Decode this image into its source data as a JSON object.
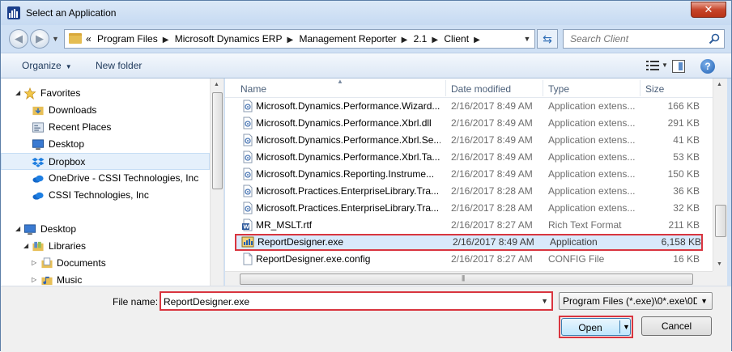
{
  "window": {
    "title": "Select an Application",
    "close_glyph": "✕"
  },
  "address": {
    "prefix": "«",
    "crumbs": [
      "Program Files",
      "Microsoft Dynamics ERP",
      "Management Reporter",
      "2.1",
      "Client"
    ],
    "search_placeholder": "Search Client"
  },
  "toolbar": {
    "organize": "Organize",
    "new_folder": "New folder",
    "help": "?"
  },
  "nav": {
    "items": [
      {
        "label": "Favorites",
        "icon": "star-icon",
        "level": 0,
        "expanded": true
      },
      {
        "label": "Downloads",
        "icon": "downloads-folder-icon",
        "level": 1
      },
      {
        "label": "Recent Places",
        "icon": "recent-places-icon",
        "level": 1
      },
      {
        "label": "Desktop",
        "icon": "desktop-icon",
        "level": 1
      },
      {
        "label": "Dropbox",
        "icon": "dropbox-icon",
        "level": 1,
        "selected": true
      },
      {
        "label": "OneDrive - CSSI Technologies, Inc",
        "icon": "onedrive-icon",
        "level": 1
      },
      {
        "label": "CSSI Technologies, Inc",
        "icon": "onedrive-icon",
        "level": 1
      },
      {
        "label": "Desktop",
        "icon": "desktop-icon",
        "level": 0,
        "expanded": true
      },
      {
        "label": "Libraries",
        "icon": "libraries-icon",
        "level": 1,
        "expanded": true
      },
      {
        "label": "Documents",
        "icon": "documents-icon",
        "level": 2
      },
      {
        "label": "Music",
        "icon": "music-icon",
        "level": 2
      }
    ]
  },
  "files": {
    "columns": {
      "name": "Name",
      "date": "Date modified",
      "type": "Type",
      "size": "Size"
    },
    "rows": [
      {
        "name": "Microsoft.Dynamics.Performance.Wizard...",
        "date": "2/16/2017 8:49 AM",
        "type": "Application extens...",
        "size": "166 KB",
        "icon": "dll-icon"
      },
      {
        "name": "Microsoft.Dynamics.Performance.Xbrl.dll",
        "date": "2/16/2017 8:49 AM",
        "type": "Application extens...",
        "size": "291 KB",
        "icon": "dll-icon"
      },
      {
        "name": "Microsoft.Dynamics.Performance.Xbrl.Se...",
        "date": "2/16/2017 8:49 AM",
        "type": "Application extens...",
        "size": "41 KB",
        "icon": "dll-icon"
      },
      {
        "name": "Microsoft.Dynamics.Performance.Xbrl.Ta...",
        "date": "2/16/2017 8:49 AM",
        "type": "Application extens...",
        "size": "53 KB",
        "icon": "dll-icon"
      },
      {
        "name": "Microsoft.Dynamics.Reporting.Instrume...",
        "date": "2/16/2017 8:49 AM",
        "type": "Application extens...",
        "size": "150 KB",
        "icon": "dll-icon"
      },
      {
        "name": "Microsoft.Practices.EnterpriseLibrary.Tra...",
        "date": "2/16/2017 8:28 AM",
        "type": "Application extens...",
        "size": "36 KB",
        "icon": "dll-icon"
      },
      {
        "name": "Microsoft.Practices.EnterpriseLibrary.Tra...",
        "date": "2/16/2017 8:28 AM",
        "type": "Application extens...",
        "size": "32 KB",
        "icon": "dll-icon"
      },
      {
        "name": "MR_MSLT.rtf",
        "date": "2/16/2017 8:27 AM",
        "type": "Rich Text Format",
        "size": "211 KB",
        "icon": "rtf-icon"
      },
      {
        "name": "ReportDesigner.exe",
        "date": "2/16/2017 8:49 AM",
        "type": "Application",
        "size": "6,158 KB",
        "icon": "exe-icon",
        "highlighted": true
      },
      {
        "name": "ReportDesigner.exe.config",
        "date": "2/16/2017 8:27 AM",
        "type": "CONFIG File",
        "size": "16 KB",
        "icon": "config-file-icon"
      }
    ]
  },
  "footer": {
    "file_name_label": "File name:",
    "file_name_value": "ReportDesigner.exe",
    "filter_value": "Program Files (*.exe)\\0*.exe\\0D",
    "open_label": "Open",
    "cancel_label": "Cancel"
  },
  "colors": {
    "highlight_border": "#d9353f",
    "selection": "#d9e9fb",
    "accent": "#1e395b"
  }
}
